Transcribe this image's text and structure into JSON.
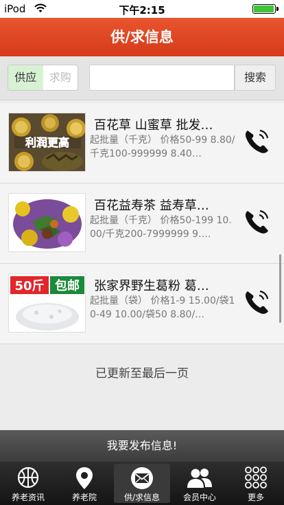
{
  "status": {
    "carrier": "iPod",
    "time": "下午2:15",
    "battery": 0.95
  },
  "nav": {
    "title": "供/求信息"
  },
  "search": {
    "supply": "供应",
    "demand": "求购",
    "placeholder": "",
    "button": "搜索"
  },
  "items": [
    {
      "title": "百花草 山蜜草 批发…",
      "desc": "起批量（千克） 价格50-99 8.80/千克100-999999 8.40…",
      "thumb_text": "利润更高"
    },
    {
      "title": "百花益寿茶 益寿草…",
      "desc": "起批量（千克） 价格50-199 10.00/千克200-7999999 9.…"
    },
    {
      "title": "张家界野生葛粉 葛…",
      "desc": "起批量（袋） 价格1-9 15.00/袋10-49 10.00/袋50 8.80/…",
      "badge_left": "50斤",
      "badge_right": "包邮"
    }
  ],
  "end_text": "已更新至最后一页",
  "publish": "我要发布信息!",
  "tabs": [
    "养老资讯",
    "养老院",
    "供/求信息",
    "会员中心",
    "更多"
  ],
  "colors": {
    "accent": "#d94020",
    "segment_on": "#d7f2d3"
  },
  "icons": [
    "wifi-icon",
    "battery-icon",
    "phone-icon",
    "basketball-icon",
    "location-pin-icon",
    "envelope-icon",
    "members-icon",
    "grid-icon"
  ]
}
